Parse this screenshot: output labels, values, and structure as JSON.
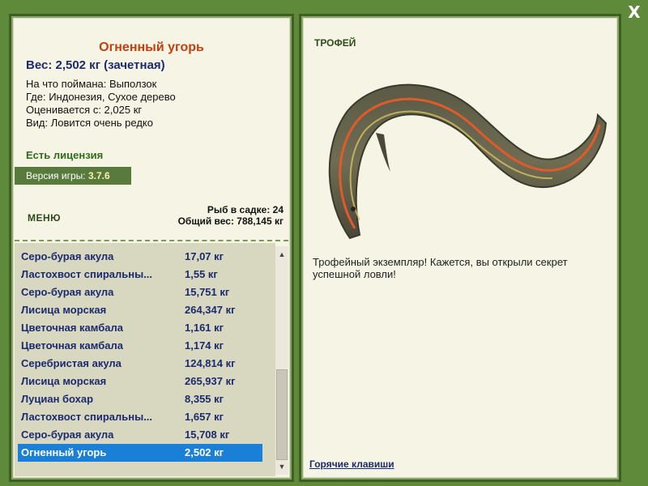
{
  "window": {
    "close_label": "X"
  },
  "fish": {
    "title": "Огненный угорь",
    "weight_line": "Вес: 2,502 кг (зачетная)",
    "details": [
      "На что поймана: Выползок",
      "Где: Индонезия, Сухое дерево",
      "Оценивается с: 2,025 кг",
      "Вид: Ловится очень редко"
    ]
  },
  "license_text": "Есть лицензия",
  "version": {
    "label": "Версия игры: ",
    "value": "3.7.6"
  },
  "menu_label": "МЕНЮ",
  "cage": {
    "count_line": "Рыб в садке: 24",
    "total_line": "Общий вес: 788,145 кг"
  },
  "catch_list": [
    {
      "name": "Серо-бурая акула",
      "weight": "17,07 кг"
    },
    {
      "name": "Ластохвост спиральны...",
      "weight": "1,55 кг"
    },
    {
      "name": "Серо-бурая акула",
      "weight": "15,751 кг"
    },
    {
      "name": "Лисица морская",
      "weight": "264,347 кг"
    },
    {
      "name": "Цветочная камбала",
      "weight": "1,161 кг"
    },
    {
      "name": "Цветочная камбала",
      "weight": "1,174 кг"
    },
    {
      "name": "Серебристая акула",
      "weight": "124,814 кг"
    },
    {
      "name": "Лисица морская",
      "weight": "265,937 кг"
    },
    {
      "name": "Луциан бохар",
      "weight": "8,355 кг"
    },
    {
      "name": "Ластохвост спиральны...",
      "weight": "1,657 кг"
    },
    {
      "name": "Серо-бурая акула",
      "weight": "15,708 кг"
    },
    {
      "name": "Огненный угорь",
      "weight": "2,502 кг",
      "selected": true
    }
  ],
  "scroll": {
    "up": "▲",
    "down": "▼"
  },
  "trophy": {
    "label": "ТРОФЕЙ",
    "text": "Трофейный экземпляр! Кажется, вы открыли секрет успешной ловли!"
  },
  "hotkeys_label": "Горячие клавиши",
  "colors": {
    "frame_green": "#5f8a3a",
    "panel_bg": "#f6f4e4",
    "title_orange": "#c04010",
    "text_navy": "#1c2a6e",
    "license_green": "#2f6e1a",
    "selection_blue": "#1a7fd6",
    "list_bg": "#d8d8c0"
  }
}
